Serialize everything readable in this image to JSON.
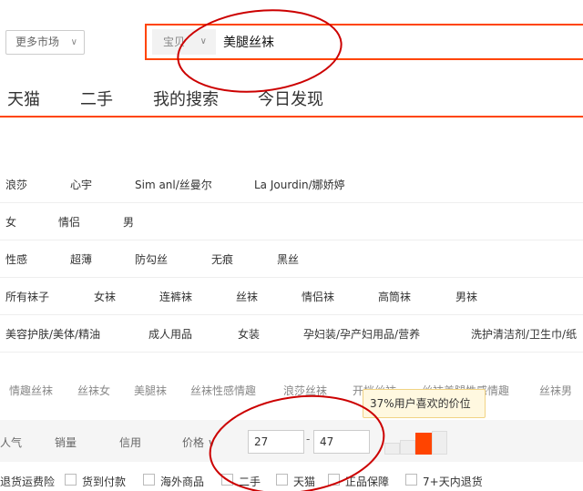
{
  "market_select": {
    "label": "更多市场"
  },
  "search": {
    "type_label": "宝贝",
    "query": "美腿丝袜"
  },
  "nav": {
    "tabs": [
      "天猫",
      "二手",
      "我的搜索",
      "今日发现"
    ]
  },
  "brands": [
    "浪莎",
    "心宇",
    "Sim anl/丝曼尔",
    "La Jourdin/娜娇婷"
  ],
  "gender": [
    "女",
    "情侣",
    "男"
  ],
  "style": [
    "性感",
    "超薄",
    "防勾丝",
    "无痕",
    "黑丝"
  ],
  "category": [
    "所有袜子",
    "女袜",
    "连裤袜",
    "丝袜",
    "情侣袜",
    "高筒袜",
    "男袜"
  ],
  "market_cats": [
    "美容护肤/美体/精油",
    "成人用品",
    "女装",
    "孕妇装/孕产妇用品/营养",
    "洗护清洁剂/卫生巾/纸"
  ],
  "related": [
    "情趣丝袜",
    "丝袜女",
    "美腿袜",
    "丝袜性感情趣",
    "浪莎丝袜",
    "开档丝袜",
    "丝袜美腿性感情趣",
    "丝袜男"
  ],
  "sort": {
    "popularity": "人气",
    "sales": "销量",
    "credit": "信用",
    "price": "价格"
  },
  "price_range": {
    "min": "27",
    "max": "47",
    "dash": "-"
  },
  "price_tip": "37%用户喜欢的价位",
  "services": [
    "退货运费险",
    "货到付款",
    "海外商品",
    "二手",
    "天猫",
    "正品保障",
    "7+天内退货"
  ],
  "colors": {
    "accent": "#ff4400",
    "annotation": "#cc0000"
  }
}
